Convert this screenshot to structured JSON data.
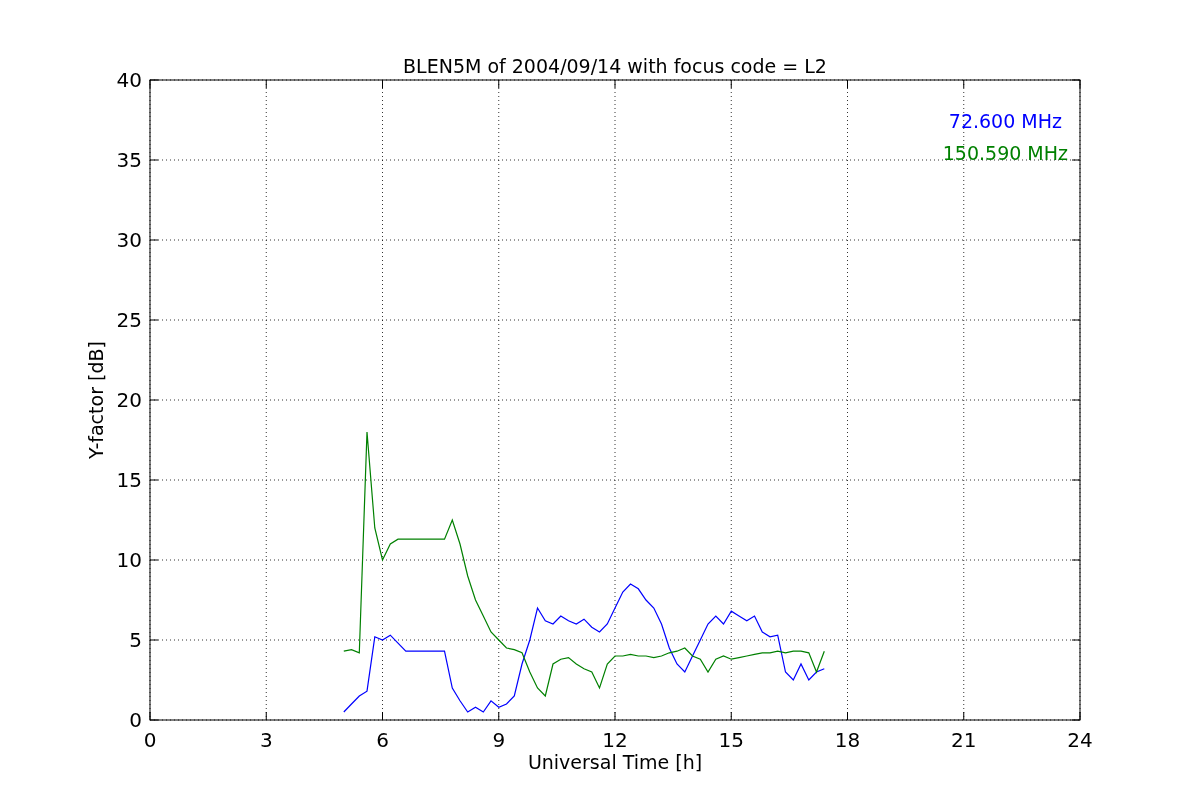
{
  "figure": {
    "chart_data": {
      "type": "line",
      "grid": true,
      "title": "BLEN5M of 2004/09/14 with focus code = L2",
      "xlabel": "Universal Time [h]",
      "ylabel": "Y-factor [dB]",
      "xlim": [
        0,
        24
      ],
      "ylim": [
        0,
        40
      ],
      "xticks": [
        0,
        3,
        6,
        9,
        12,
        15,
        18,
        21,
        24
      ],
      "yticks": [
        0,
        5,
        10,
        15,
        20,
        25,
        30,
        35,
        40
      ],
      "x": [
        5.0,
        5.2,
        5.4,
        5.6,
        5.8,
        6.0,
        6.2,
        6.4,
        6.6,
        6.8,
        7.0,
        7.2,
        7.4,
        7.6,
        7.8,
        8.0,
        8.2,
        8.4,
        8.6,
        8.8,
        9.0,
        9.2,
        9.4,
        9.6,
        9.8,
        10.0,
        10.2,
        10.4,
        10.6,
        10.8,
        11.0,
        11.2,
        11.4,
        11.6,
        11.8,
        12.0,
        12.2,
        12.4,
        12.6,
        12.8,
        13.0,
        13.2,
        13.4,
        13.6,
        13.8,
        14.0,
        14.2,
        14.4,
        14.6,
        14.8,
        15.0,
        15.2,
        15.4,
        15.6,
        15.8,
        16.0,
        16.2,
        16.4,
        16.6,
        16.8,
        17.0,
        17.2,
        17.4
      ],
      "series": [
        {
          "name": "72.600 MHz",
          "color": "#0000ff",
          "values": [
            0.5,
            1.0,
            1.5,
            1.8,
            5.2,
            5.0,
            5.3,
            4.8,
            4.3,
            4.3,
            4.3,
            4.3,
            4.3,
            4.3,
            2.0,
            1.2,
            0.5,
            0.8,
            0.5,
            1.2,
            0.8,
            1.0,
            1.5,
            3.5,
            5.0,
            7.0,
            6.2,
            6.0,
            6.5,
            6.2,
            6.0,
            6.3,
            5.8,
            5.5,
            6.0,
            7.0,
            8.0,
            8.5,
            8.2,
            7.5,
            7.0,
            6.0,
            4.5,
            3.5,
            3.0,
            4.0,
            5.0,
            6.0,
            6.5,
            6.0,
            6.8,
            6.5,
            6.2,
            6.5,
            5.5,
            5.2,
            5.3,
            3.0,
            2.5,
            3.5,
            2.5,
            3.0,
            3.2
          ]
        },
        {
          "name": "150.590 MHz",
          "color": "#008000",
          "values": [
            4.3,
            4.4,
            4.2,
            18,
            12,
            10,
            11,
            11.3,
            11.3,
            11.3,
            11.3,
            11.3,
            11.3,
            11.3,
            12.5,
            11,
            9,
            7.5,
            6.5,
            5.5,
            5.0,
            4.5,
            4.4,
            4.2,
            3.0,
            2.0,
            1.5,
            3.5,
            3.8,
            3.9,
            3.5,
            3.2,
            3.0,
            2.0,
            3.5,
            4.0,
            4.0,
            4.1,
            4.0,
            4.0,
            3.9,
            4.0,
            4.2,
            4.3,
            4.5,
            4.0,
            3.8,
            3.0,
            3.8,
            4.0,
            3.8,
            3.9,
            4.0,
            4.1,
            4.2,
            4.2,
            4.3,
            4.2,
            4.3,
            4.3,
            4.2,
            3.0,
            4.3
          ]
        }
      ]
    }
  }
}
